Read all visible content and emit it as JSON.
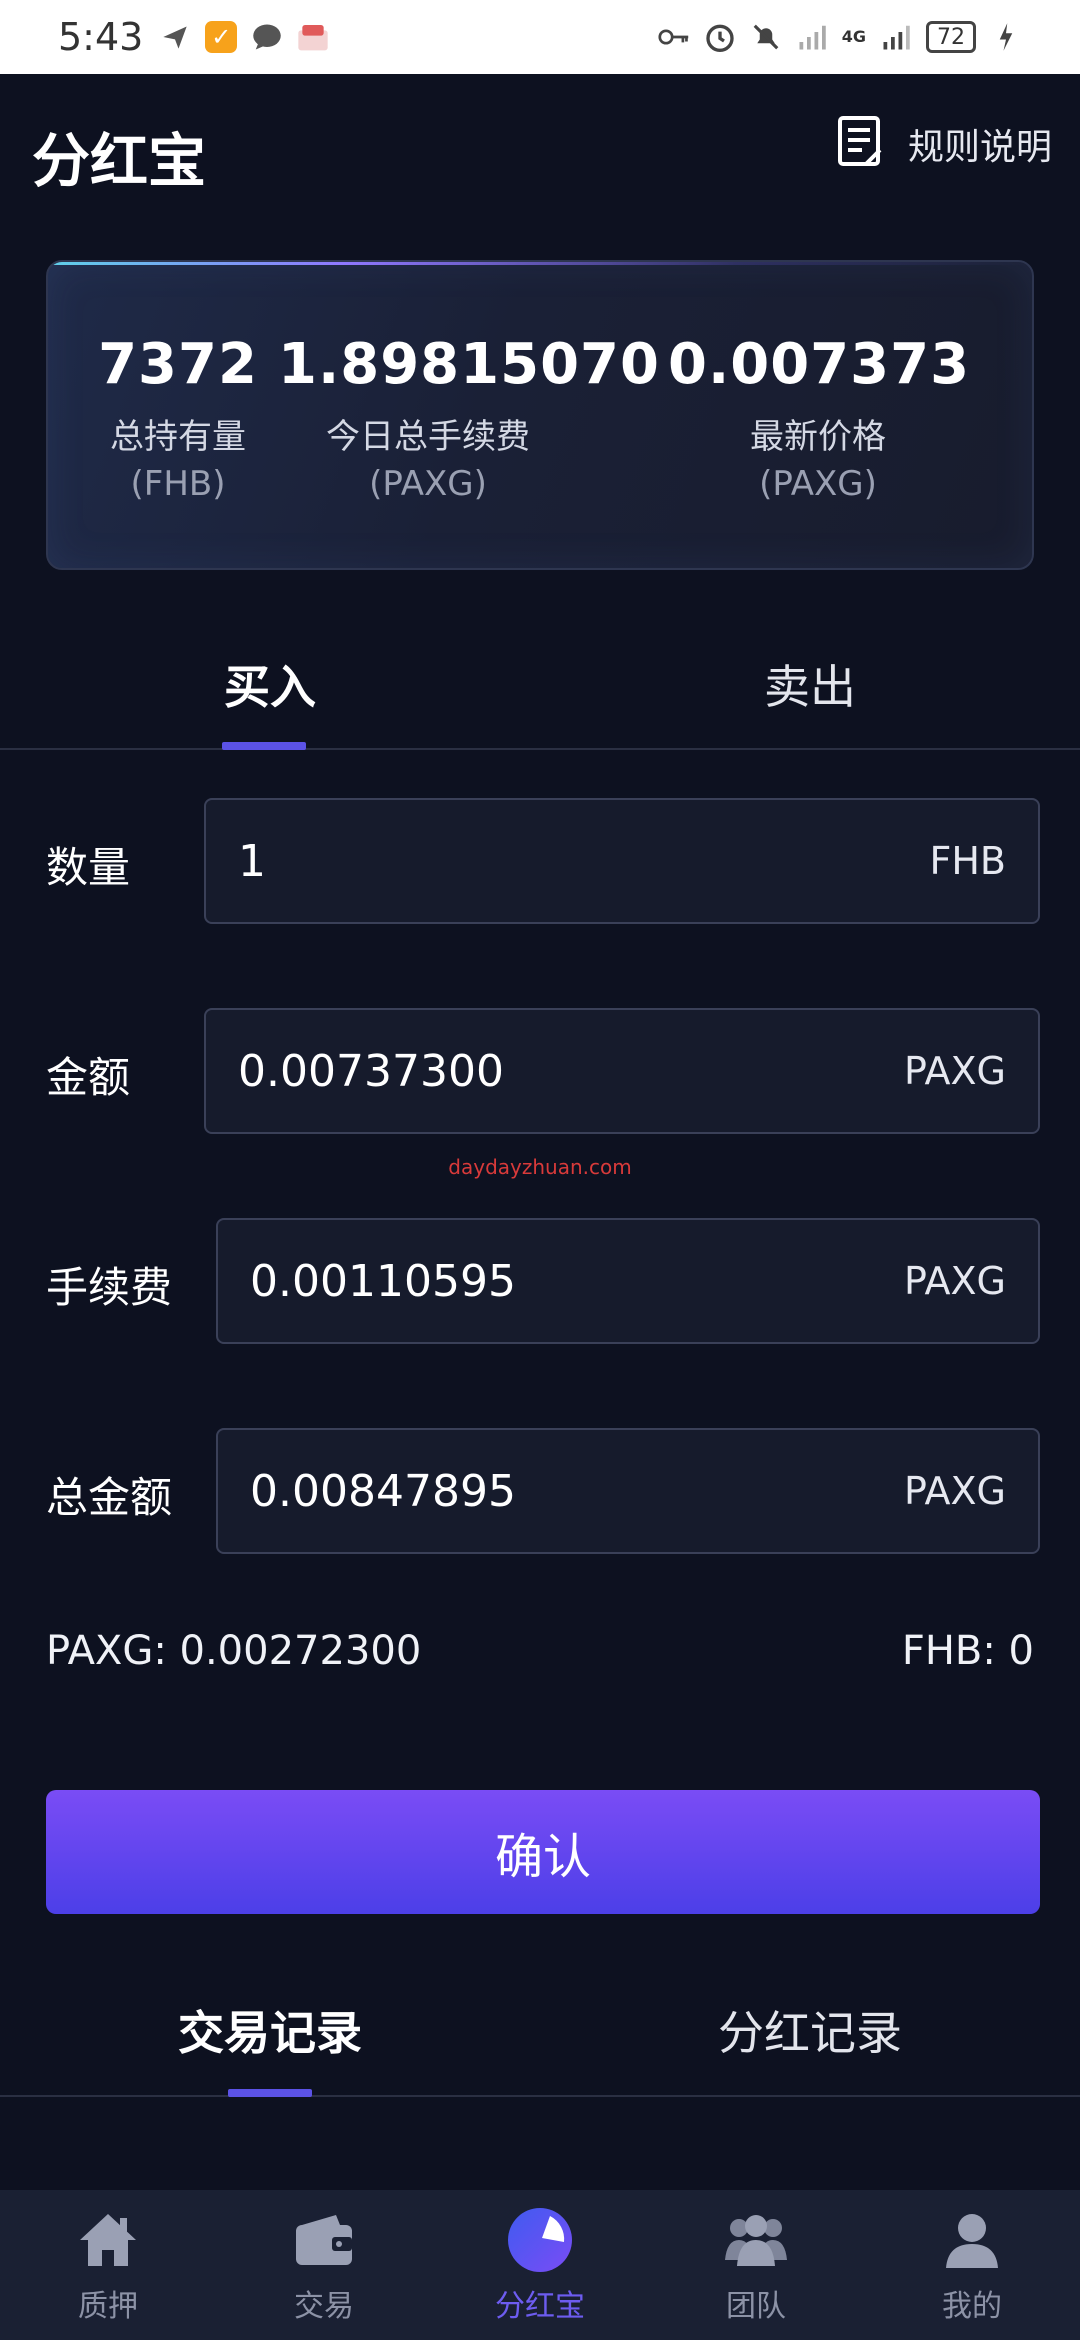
{
  "status_bar": {
    "time": "5:43",
    "battery": "72",
    "network": "4G"
  },
  "header": {
    "title": "分红宝",
    "rules_label": "规则说明"
  },
  "stats": [
    {
      "value": "7372",
      "label": "总持有量",
      "unit": "(FHB)"
    },
    {
      "value": "1.89815070",
      "label": "今日总手续费",
      "unit": "(PAXG)"
    },
    {
      "value": "0.007373",
      "label": "最新价格",
      "unit": "(PAXG)"
    }
  ],
  "trade_tabs": {
    "buy": "买入",
    "sell": "卖出",
    "active": "buy"
  },
  "form": {
    "quantity": {
      "label": "数量",
      "value": "1",
      "unit": "FHB"
    },
    "amount": {
      "label": "金额",
      "value": "0.00737300",
      "unit": "PAXG"
    },
    "fee": {
      "label": "手续费",
      "value": "0.00110595",
      "unit": "PAXG"
    },
    "total": {
      "label": "总金额",
      "value": "0.00847895",
      "unit": "PAXG"
    }
  },
  "watermark": "daydayzhuan.com",
  "balances": {
    "paxg": "PAXG:  0.00272300",
    "fhb": "FHB:  0"
  },
  "confirm_label": "确认",
  "record_tabs": {
    "trade": "交易记录",
    "dividend": "分红记录",
    "active": "trade"
  },
  "bottom_nav": [
    {
      "label": "质押",
      "icon": "home-icon"
    },
    {
      "label": "交易",
      "icon": "wallet-icon"
    },
    {
      "label": "分红宝",
      "icon": "pie-chart-icon",
      "active": true
    },
    {
      "label": "团队",
      "icon": "team-icon"
    },
    {
      "label": "我的",
      "icon": "user-icon"
    }
  ],
  "colors": {
    "background": "#0d1120",
    "accent": "#5b52e6",
    "button_top": "#7a4cf5",
    "button_bottom": "#4c3fe8",
    "nav_inactive": "#8c92a6"
  }
}
